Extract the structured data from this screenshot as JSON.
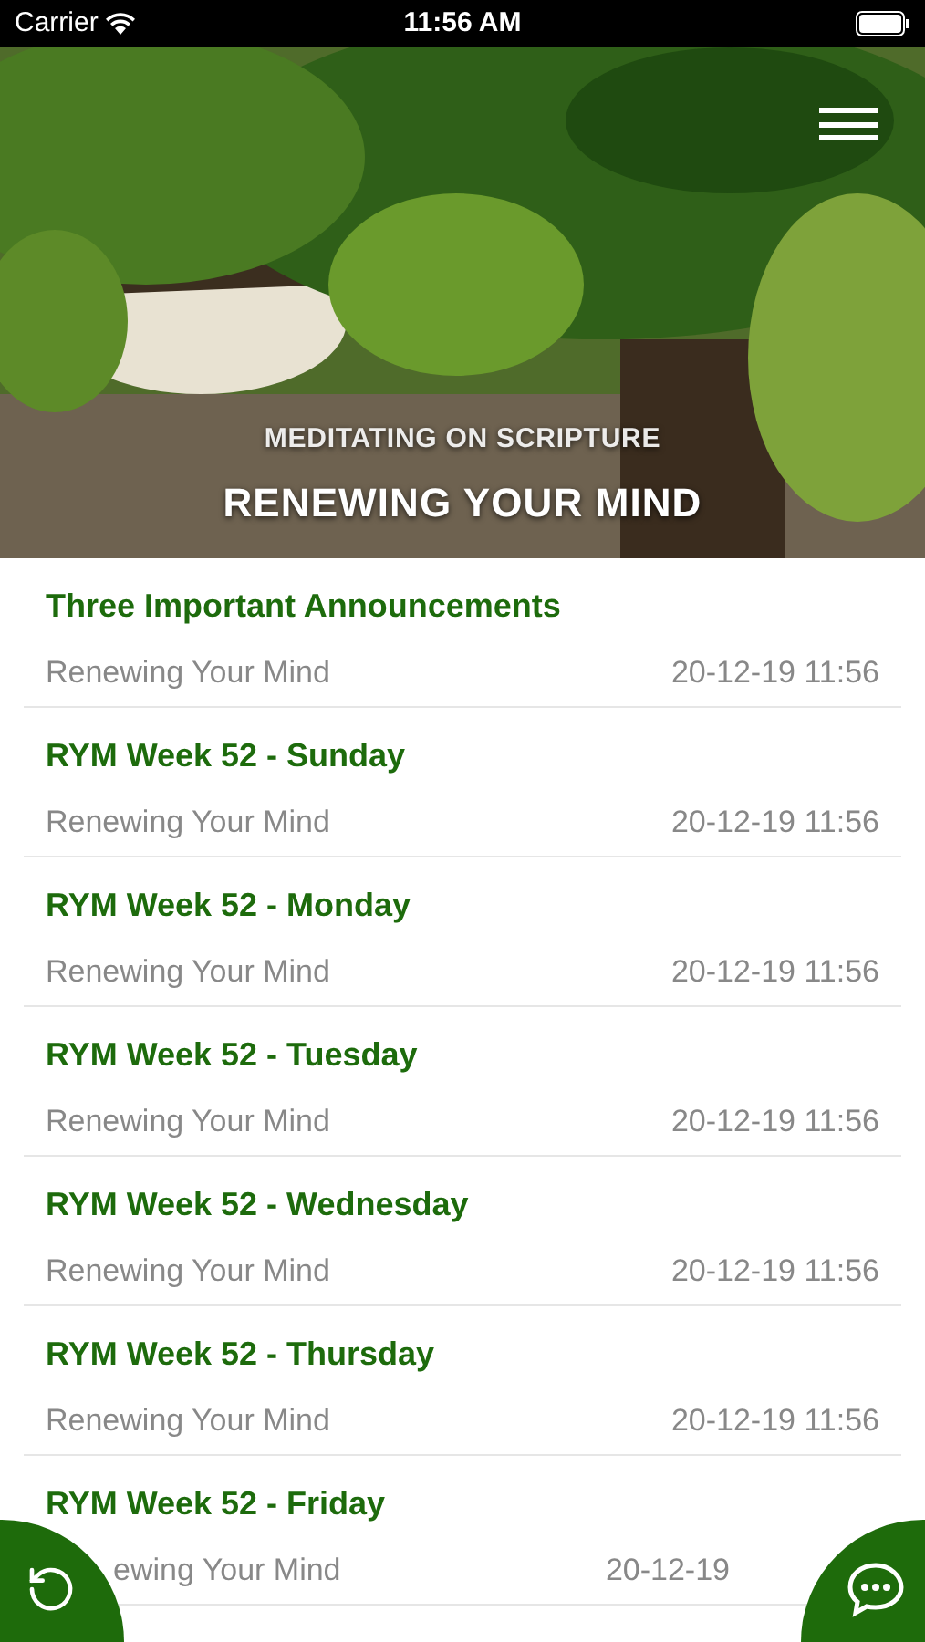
{
  "status_bar": {
    "carrier": "Carrier",
    "time": "11:56 AM"
  },
  "header": {
    "kind": "picture",
    "subtitle": "MEDITATING ON SCRIPTURE",
    "title": "RENEWING YOUR MIND"
  },
  "posts": [
    {
      "title": "Three Important Announcements",
      "source": "Renewing Your Mind",
      "date": "20-12-19 11:56"
    },
    {
      "title": "RYM Week 52 - Sunday",
      "source": "Renewing Your Mind",
      "date": "20-12-19 11:56"
    },
    {
      "title": "RYM Week 52 - Monday",
      "source": "Renewing Your Mind",
      "date": "20-12-19 11:56"
    },
    {
      "title": "RYM Week 52 - Tuesday",
      "source": "Renewing Your Mind",
      "date": "20-12-19 11:56"
    },
    {
      "title": "RYM Week 52 - Wednesday",
      "source": "Renewing Your Mind",
      "date": "20-12-19 11:56"
    },
    {
      "title": "RYM Week 52 - Thursday",
      "source": "Renewing Your Mind",
      "date": "20-12-19 11:56"
    },
    {
      "title": "RYM Week 52 - Friday",
      "source": "ewing Your Mind",
      "date": "20-12-19"
    }
  ]
}
